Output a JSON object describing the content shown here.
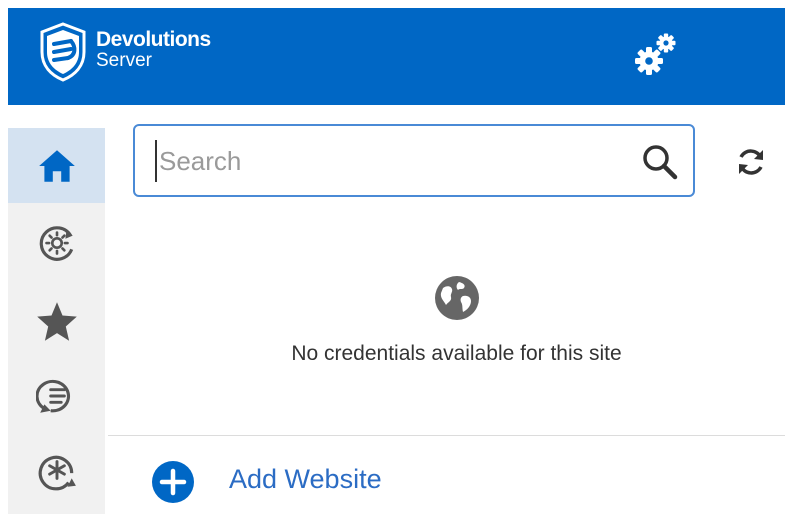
{
  "header": {
    "brand_name": "Devolutions",
    "brand_sub": "Server",
    "background": "#0067c5",
    "logo_icon": "devolutions-shield-logo",
    "settings_icon": "gears-icon"
  },
  "sidebar": {
    "items": [
      {
        "id": "home",
        "icon": "home-icon",
        "active": true
      },
      {
        "id": "recent",
        "icon": "recent-sun-icon",
        "active": false
      },
      {
        "id": "favorites",
        "icon": "star-icon",
        "active": false
      },
      {
        "id": "notes",
        "icon": "comment-list-icon",
        "active": false
      },
      {
        "id": "generator",
        "icon": "asterisk-sync-icon",
        "active": false
      }
    ]
  },
  "search": {
    "placeholder": "Search",
    "value": "",
    "icon": "search-icon"
  },
  "refresh": {
    "icon": "refresh-icon"
  },
  "empty_state": {
    "icon": "globe-icon",
    "message": "No credentials available for this site"
  },
  "footer": {
    "add_label": "Add Website",
    "add_icon": "plus-circle-icon",
    "accent": "#2b6cc4"
  }
}
